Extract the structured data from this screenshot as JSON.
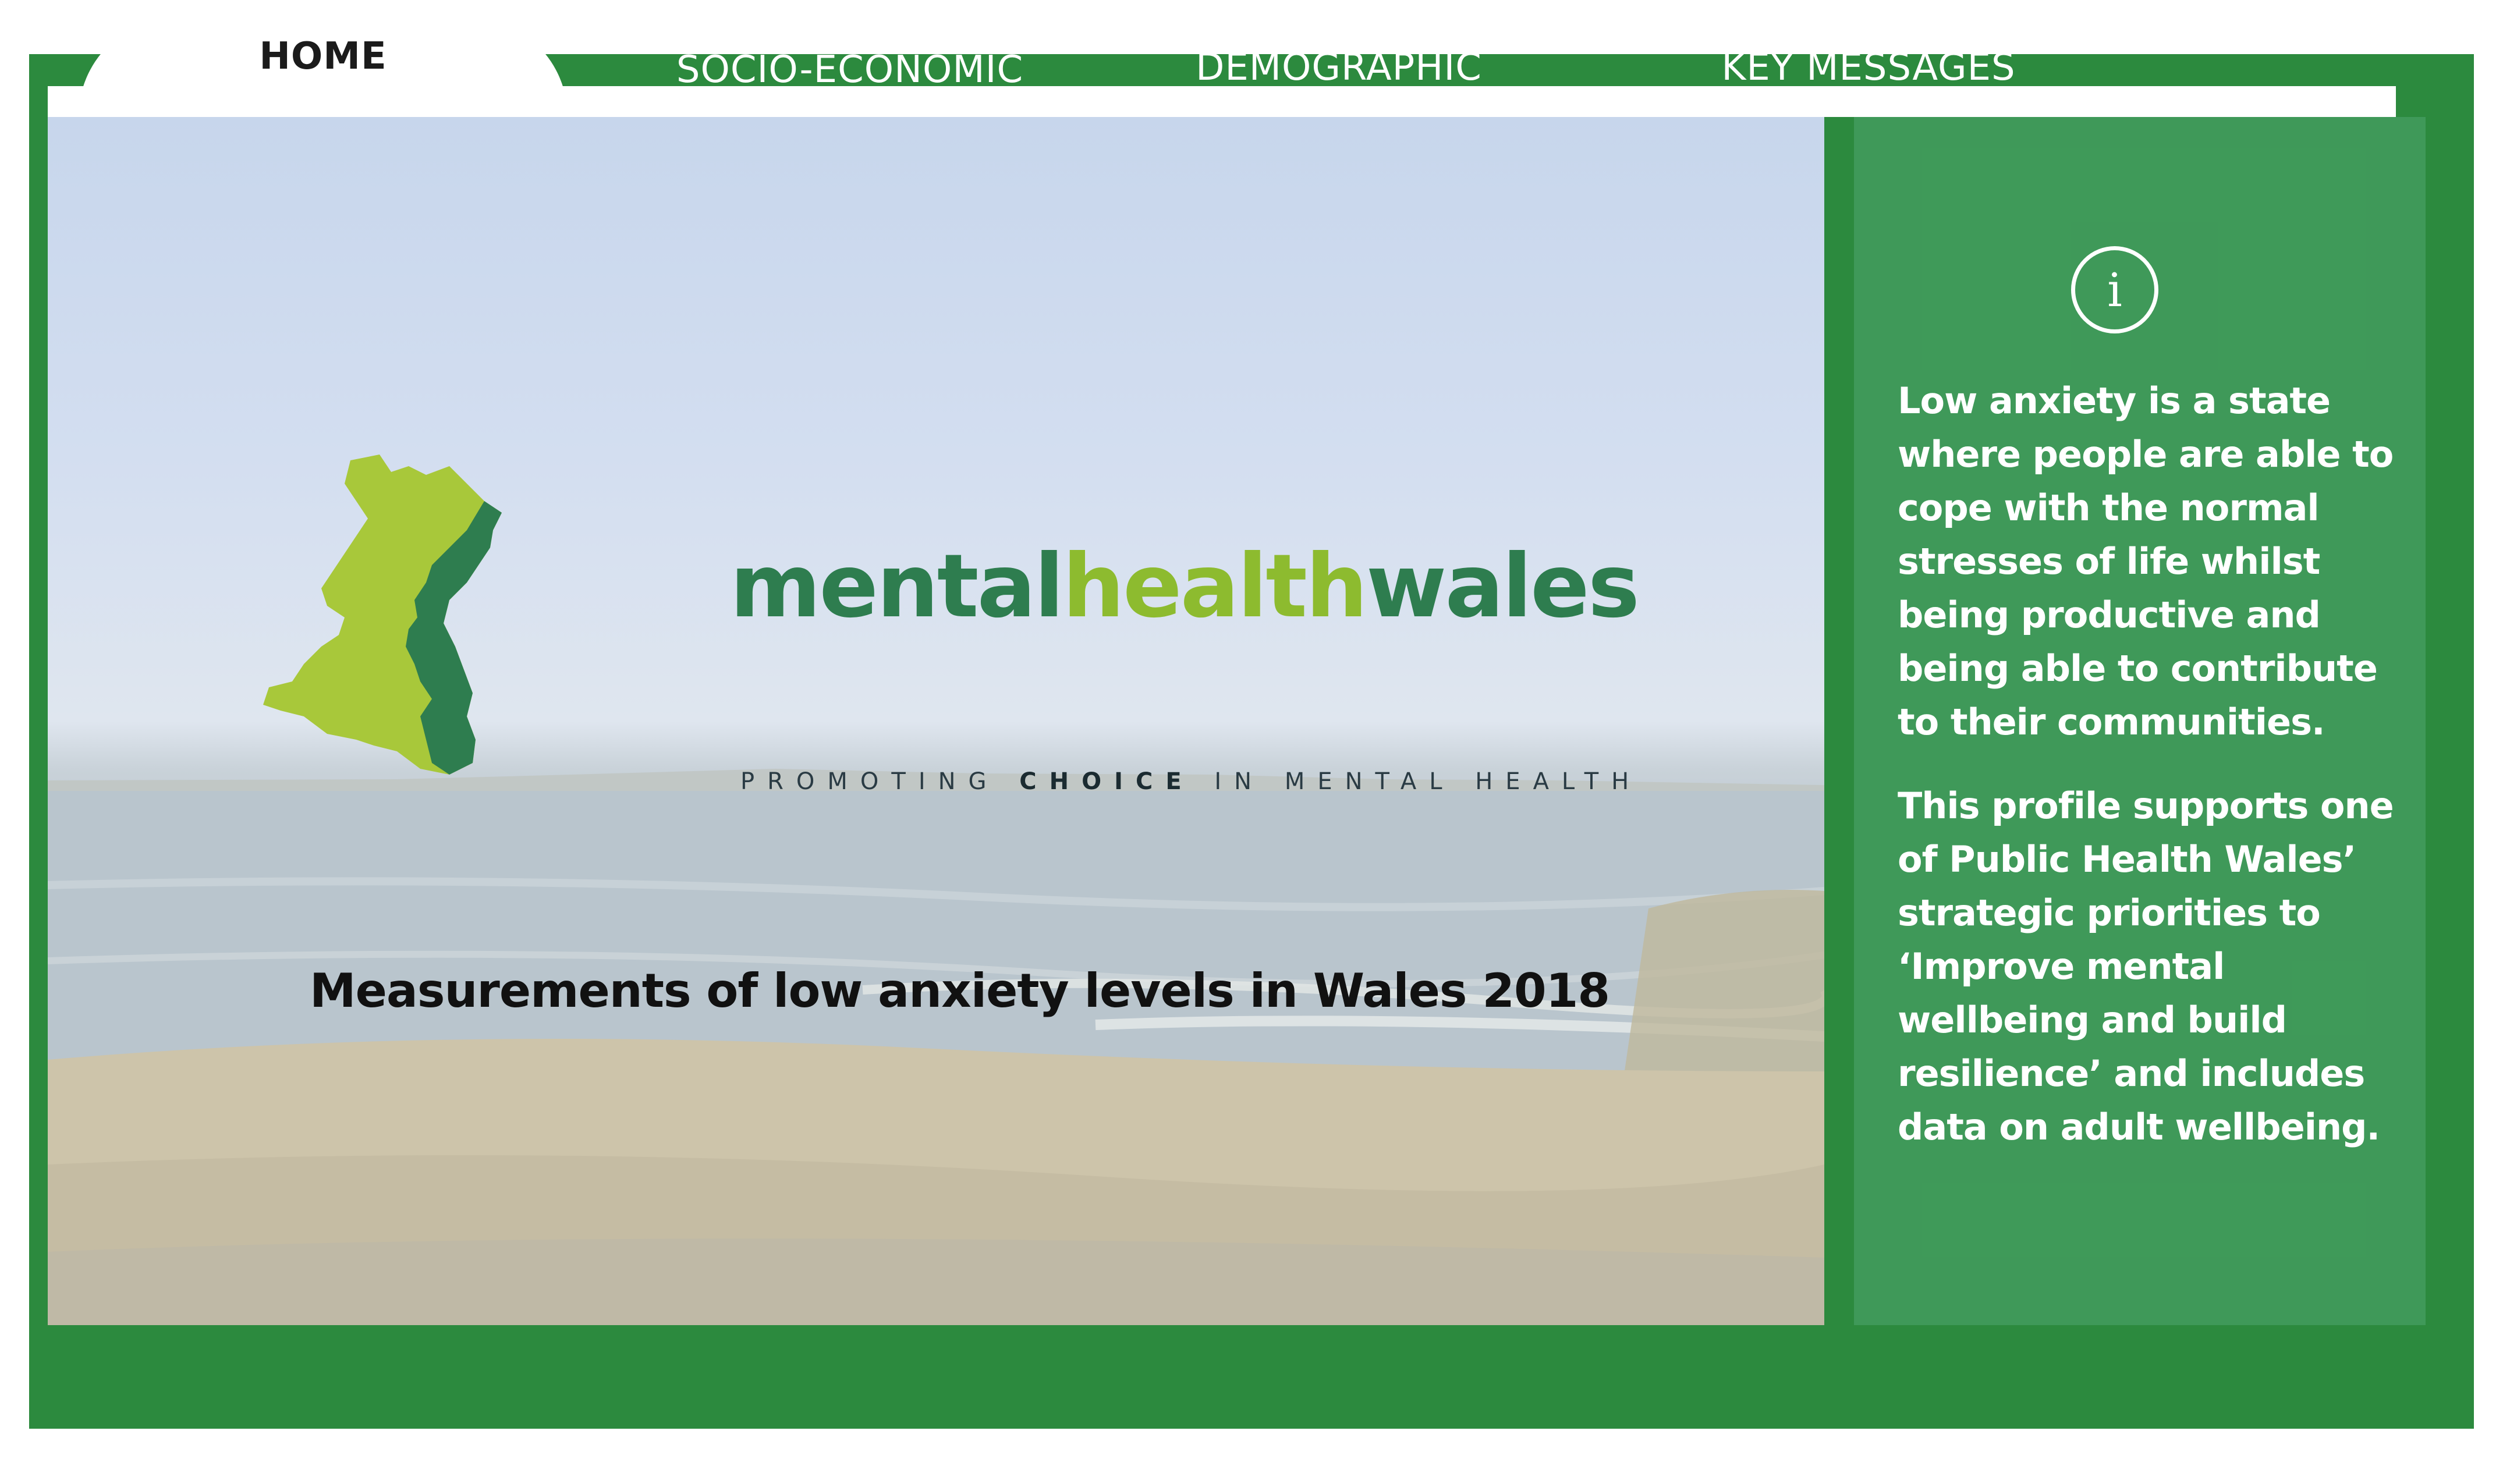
{
  "nav": {
    "tabs": [
      {
        "label": "HOME",
        "active": true
      },
      {
        "label": "SOCIO-ECONOMIC",
        "active": false
      },
      {
        "label": "DEMOGRAPHIC",
        "active": false
      },
      {
        "label": "KEY MESSAGES",
        "active": false
      }
    ]
  },
  "logo": {
    "word_part1": "mental",
    "word_part2": "health",
    "word_part3": "wales",
    "tagline_pre": "PROMOTING ",
    "tagline_bold": "CHOICE",
    "tagline_post": " IN MENTAL HEALTH"
  },
  "main": {
    "title": "Measurements of low anxiety levels in Wales 2018"
  },
  "info": {
    "icon": "info-icon",
    "paragraph1": "Low anxiety is a state where people are able to cope with the normal stresses of life whilst being productive and being able to contribute to their communities.",
    "paragraph2": "This profile supports one of Public Health Wales’ strategic priorities to ‘Improve mental wellbeing and build resilience’ and includes data on adult wellbeing."
  },
  "colors": {
    "frame": "#2c8a3e",
    "panel": "#46a064",
    "brand_dark": "#2e7d4f",
    "brand_light": "#8dbb2f"
  }
}
